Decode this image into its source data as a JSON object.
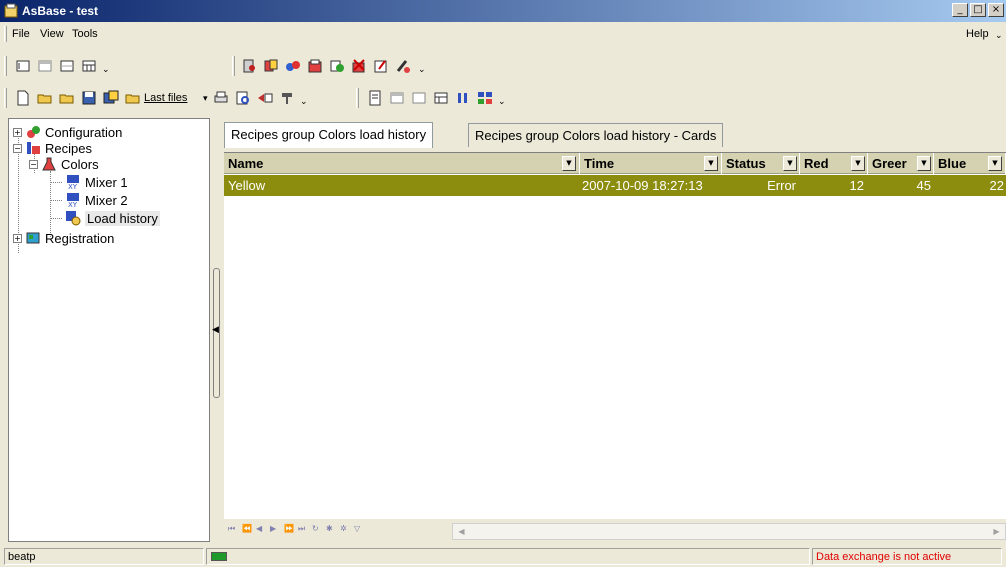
{
  "window": {
    "title": "AsBase - test",
    "buttons": [
      "_",
      "□",
      "×"
    ]
  },
  "menu": {
    "items": [
      "File",
      "View",
      "Tools"
    ],
    "help": "Help"
  },
  "toolbar": {
    "last_files_label": "Last files"
  },
  "tree": {
    "items": [
      {
        "label": "Configuration",
        "icon": "configuration-icon"
      },
      {
        "label": "Recipes",
        "icon": "recipes-icon"
      },
      {
        "label": "Colors",
        "icon": "flask-icon"
      },
      {
        "label": "Mixer 1",
        "icon": "xy-table-icon"
      },
      {
        "label": "Mixer 2",
        "icon": "xy-table-icon"
      },
      {
        "label": "Load history",
        "icon": "load-history-icon"
      },
      {
        "label": "Registration",
        "icon": "registration-icon"
      }
    ]
  },
  "tabs": [
    "Recipes group Colors load history",
    "Recipes group Colors load history - Cards"
  ],
  "grid": {
    "columns": [
      "Name",
      "Time",
      "Status",
      "Red",
      "Greer",
      "Blue"
    ],
    "rows": [
      {
        "name": "Yellow",
        "time": "2007-10-09 18:27:13",
        "status": "Error",
        "red": "12",
        "green": "45",
        "blue": "22"
      }
    ]
  },
  "status": {
    "user": "beatp",
    "message": "Data exchange is not active",
    "message_color": "#e00000"
  },
  "colors": {
    "selected_row": "#8c8c0e",
    "header": "#d5d2b1",
    "title_start": "#0a246a"
  }
}
